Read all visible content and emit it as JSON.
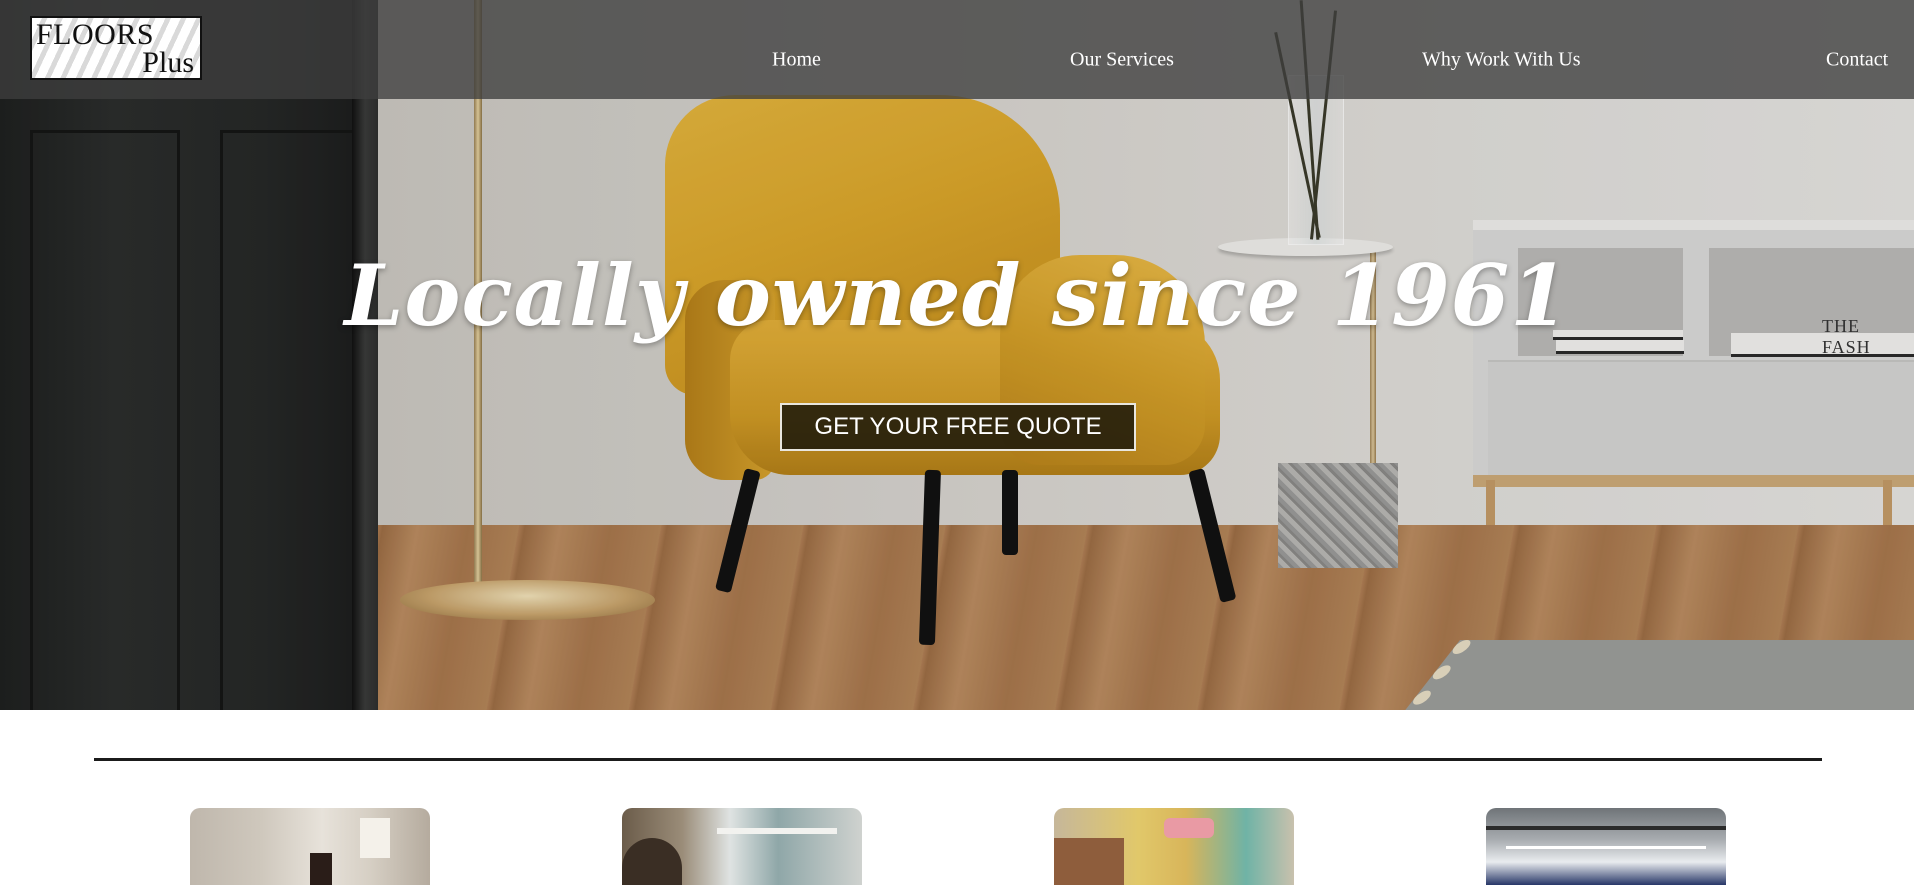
{
  "header": {
    "logo": {
      "line1": "FLOORS",
      "line2": "Plus"
    },
    "nav": [
      {
        "label": "Home"
      },
      {
        "label": "Our Services"
      },
      {
        "label": "Why Work With Us"
      },
      {
        "label": "Contact"
      }
    ]
  },
  "hero": {
    "headline": "Locally owned since 1961",
    "cta_label": "GET YOUR FREE QUOTE",
    "background_image": "living room with yellow armchair on wood floor",
    "book_text": "THE FASH"
  },
  "gallery": {
    "thumbnails": [
      {
        "image": "empty room with hardwood floor"
      },
      {
        "image": "installer working near window"
      },
      {
        "image": "lounge with yellow sofas"
      },
      {
        "image": "gymnasium floor"
      }
    ]
  },
  "colors": {
    "header_bg": "#3e3e3e",
    "cta_bg": "#14120a",
    "text_light": "#ffffff",
    "divider": "#1b1b1b"
  }
}
